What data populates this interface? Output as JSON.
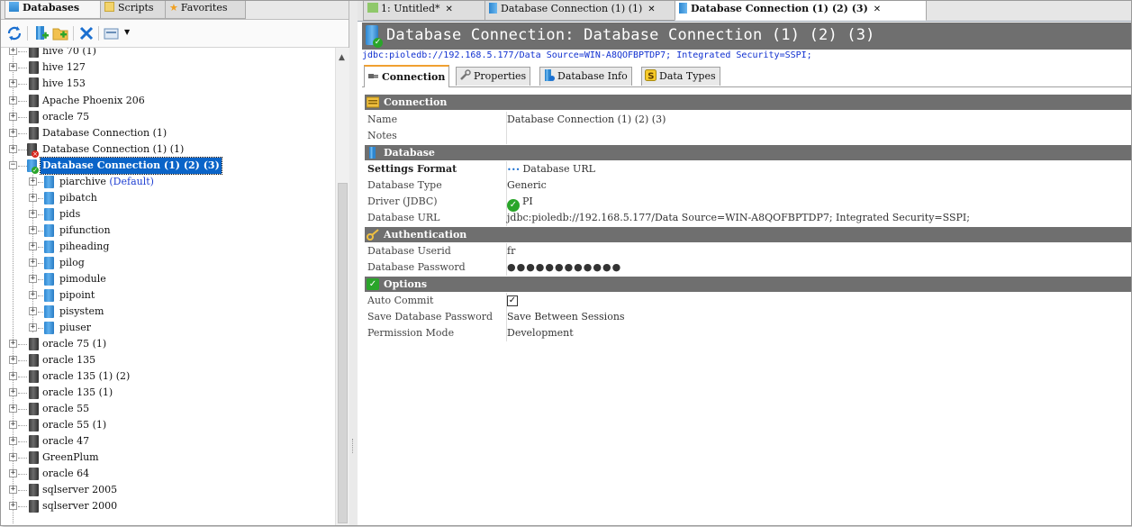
{
  "left_tabs": [
    {
      "label": "Databases",
      "active": true
    },
    {
      "label": "Scripts",
      "active": false
    },
    {
      "label": "Favorites",
      "active": false
    }
  ],
  "toolbar_icons": [
    "refresh-icon",
    "add-connection-icon",
    "new-folder-icon",
    "delete-icon",
    "filter-dropdown-icon"
  ],
  "tree": {
    "connections_top": [
      {
        "label": "hive 70 (1)"
      },
      {
        "label": "hive 127"
      },
      {
        "label": "hive 153"
      },
      {
        "label": "Apache Phoenix 206"
      },
      {
        "label": "oracle 75"
      },
      {
        "label": "Database Connection (1)"
      },
      {
        "label": "Database Connection (1) (1)"
      }
    ],
    "selected": {
      "label": "Database Connection (1) (2) (3)"
    },
    "schemas": [
      {
        "label": "piarchive",
        "suffix": "(Default)"
      },
      {
        "label": "pibatch"
      },
      {
        "label": "pids"
      },
      {
        "label": "pifunction"
      },
      {
        "label": "piheading"
      },
      {
        "label": "pilog"
      },
      {
        "label": "pimodule"
      },
      {
        "label": "pipoint"
      },
      {
        "label": "pisystem"
      },
      {
        "label": "piuser"
      }
    ],
    "connections_bottom": [
      {
        "label": "oracle 75 (1)"
      },
      {
        "label": "oracle 135"
      },
      {
        "label": "oracle 135 (1) (2)"
      },
      {
        "label": "oracle 135 (1)"
      },
      {
        "label": "oracle 55"
      },
      {
        "label": "oracle 55 (1)"
      },
      {
        "label": "oracle 47"
      },
      {
        "label": "GreenPlum"
      },
      {
        "label": "oracle 64"
      },
      {
        "label": "sqlserver 2005"
      },
      {
        "label": "sqlserver 2000"
      }
    ]
  },
  "editor_tabs": [
    {
      "label": "1: Untitled*",
      "active": false
    },
    {
      "label": "Database Connection (1) (1)",
      "active": false
    },
    {
      "label": "Database Connection (1) (2) (3)",
      "active": true
    }
  ],
  "header": {
    "title": "Database Connection: Database Connection (1) (2) (3)",
    "url": "jdbc:pioledb://192.168.5.177/Data Source=WIN-A8QOFBPTDP7; Integrated Security=SSPI;"
  },
  "sub_tabs": [
    {
      "label": "Connection",
      "active": true
    },
    {
      "label": "Properties",
      "active": false
    },
    {
      "label": "Database Info",
      "active": false
    },
    {
      "label": "Data Types",
      "active": false
    }
  ],
  "sections": {
    "connection": {
      "title": "Connection",
      "name_label": "Name",
      "name_value": "Database Connection (1) (2) (3)",
      "notes_label": "Notes",
      "notes_value": ""
    },
    "database": {
      "title": "Database",
      "settings_format_label": "Settings Format",
      "settings_format_value": "Database URL",
      "database_type_label": "Database Type",
      "database_type_value": "Generic",
      "driver_label": "Driver (JDBC)",
      "driver_value": "PI",
      "database_url_label": "Database URL",
      "database_url_value": "jdbc:pioledb://192.168.5.177/Data Source=WIN-A8QOFBPTDP7; Integrated Security=SSPI;"
    },
    "authentication": {
      "title": "Authentication",
      "userid_label": "Database Userid",
      "userid_value": "fr",
      "password_label": "Database Password",
      "password_value": "●●●●●●●●●●●●"
    },
    "options": {
      "title": "Options",
      "auto_commit_label": "Auto Commit",
      "auto_commit_checked": true,
      "save_password_label": "Save Database Password",
      "save_password_value": "Save Between Sessions",
      "permission_label": "Permission Mode",
      "permission_value": "Development"
    }
  },
  "colors": {
    "section_header_bg": "#6f6f6f",
    "selection_bg": "#0a64c8",
    "link_blue": "#1030d0",
    "ok_green": "#2aa52a",
    "error_red": "#d8261c"
  }
}
